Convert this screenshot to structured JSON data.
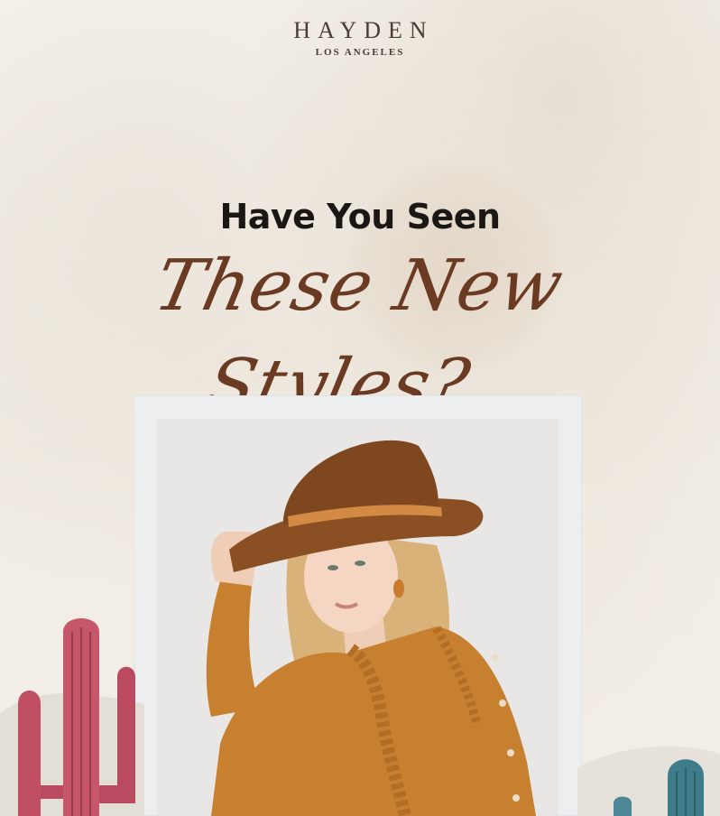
{
  "brand": {
    "name": "HAYDEN",
    "location": "LOS ANGELES"
  },
  "headline": {
    "line1": "Have You Seen",
    "line2": "These New Styles?"
  },
  "hero_image": {
    "subject": "woman-in-brown-hat"
  },
  "decor": {
    "left": "cactus-illustration",
    "right": "cactus-illustration"
  },
  "colors": {
    "background": "#f3efe9",
    "brand_text": "#4a3b33",
    "headline_text": "#1a1714",
    "script_text": "#6b3a22",
    "hat": "#8a4f22",
    "dress": "#c7802f"
  }
}
